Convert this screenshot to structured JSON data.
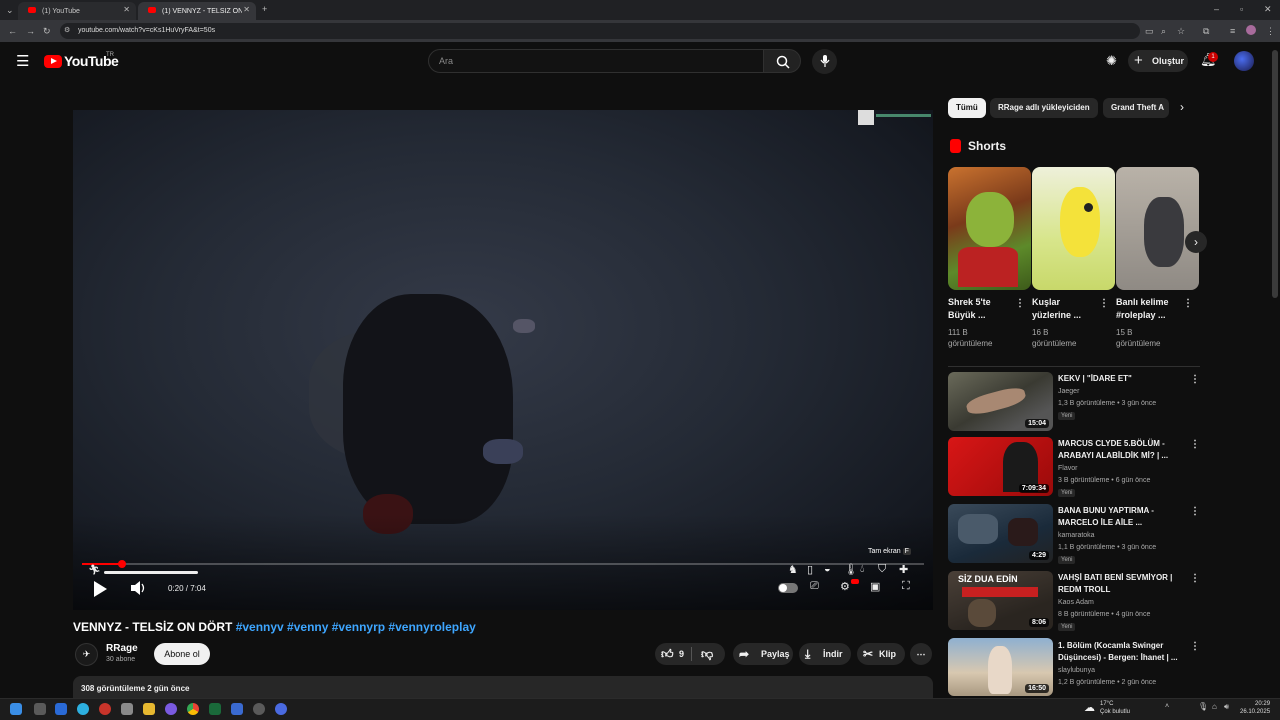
{
  "browser": {
    "tabs": [
      {
        "label": "(1) YouTube"
      },
      {
        "label": "(1) VENNYZ - TELSİZ ON DÖRT"
      }
    ],
    "url": "youtube.com/watch?v=cKs1HuVryFA&t=50s"
  },
  "header": {
    "logo_text": "YouTube",
    "region": "TR",
    "search_placeholder": "Ara",
    "create_label": "Oluştur",
    "notification_count": "1"
  },
  "player": {
    "current_time": "0:20",
    "duration": "7:04",
    "time_display": "0:20 / 7:04",
    "progress": 0.047,
    "fullscreen_tooltip": "Tam ekran",
    "fullscreen_key": "F"
  },
  "video": {
    "title": "VENNYZ - TELSİZ ON DÖRT",
    "hashtags": "#vennyv #venny #vennyrp #vennyroleplay",
    "channel": "RRage",
    "subscribers": "30 abone",
    "subscribe_label": "Abone ol",
    "likes": "9",
    "share_label": "Paylaş",
    "download_label": "İndir",
    "clip_label": "Klip",
    "description_meta": "308 görüntüleme  2 gün önce"
  },
  "sidebar": {
    "chips": [
      "Tümü",
      "RRage adlı yükleyiciden",
      "Grand Theft A"
    ],
    "shorts_heading": "Shorts",
    "shorts": [
      {
        "title_line1": "Shrek 5'te",
        "title_line2": "Büyük ...",
        "views_line1": "111 B",
        "views_line2": "görüntüleme"
      },
      {
        "title_line1": "Kuşlar",
        "title_line2": "yüzlerine ...",
        "views_line1": "16 B",
        "views_line2": "görüntüleme"
      },
      {
        "title_line1": "Banlı kelime",
        "title_line2": "#roleplay ...",
        "views_line1": "15 B",
        "views_line2": "görüntüleme"
      }
    ],
    "recommendations": [
      {
        "title": "KEKV | \"İDARE ET\"",
        "channel": "Jaeger",
        "meta": "1,3 B görüntüleme • 3 gün önce",
        "badge": "Yeni",
        "duration": "15:04"
      },
      {
        "title": "MARCUS CLYDE 5.BÖLÜM - ARABAYI ALABİLDİK Mİ? | ...",
        "channel": "Flavor",
        "meta": "3 B görüntüleme • 6 gün önce",
        "badge": "Yeni",
        "duration": "7:09:34"
      },
      {
        "title": "BANA BUNU YAPTIRMA - MARCELO İLE AİLE ...",
        "channel": "kamaratoka",
        "meta": "1,1 B görüntüleme • 3 gün önce",
        "badge": "Yeni",
        "duration": "4:29"
      },
      {
        "title": "VAHŞİ BATI BENİ SEVMİYOR | REDM TROLL",
        "channel": "Kaos Adam",
        "meta": "8 B görüntüleme • 4 gün önce",
        "badge": "Yeni",
        "duration": "8:06"
      },
      {
        "title": "1. Bölüm (Kocamla Swinger Düşüncesi) - Bergen: İhanet | ...",
        "channel": "slaylubunya",
        "meta": "1,2 B görüntüleme • 2 gün önce",
        "badge": "Yeni",
        "duration": "16:50"
      }
    ],
    "rec3_thumb_text": "SİZ DUA EDİN"
  },
  "taskbar": {
    "temperature": "17°C",
    "weather": "Çok bulutlu",
    "time": "20:29",
    "date": "26.10.2025"
  },
  "colors": {
    "accent": "#ff0000",
    "link": "#3ea6ff",
    "background": "#0f0f0f"
  }
}
